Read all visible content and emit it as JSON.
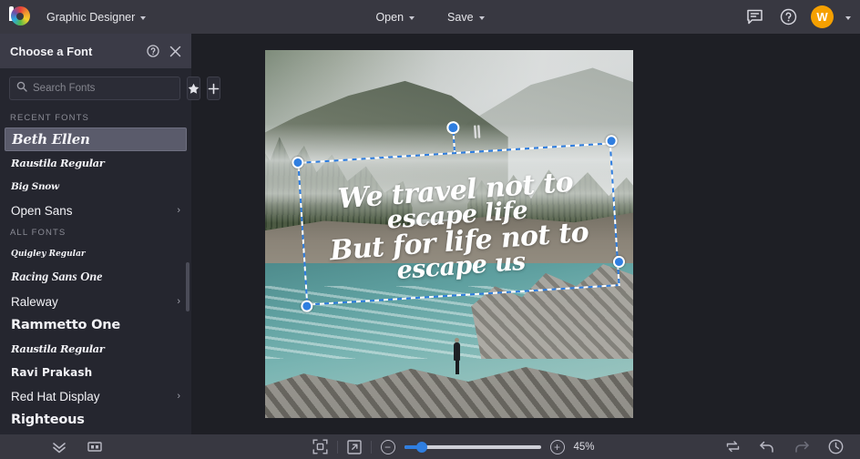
{
  "app": {
    "name": "BeFunky",
    "workspace_label": "Graphic Designer",
    "logo_icon": "befunky-logo-icon"
  },
  "topbar": {
    "open_label": "Open",
    "save_label": "Save",
    "chat_icon": "chat-bubble-icon",
    "help_icon": "question-circle-icon",
    "avatar_initial": "W",
    "avatar_color": "#f5a000"
  },
  "panel": {
    "title": "Choose a Font",
    "help_icon": "question-circle-icon",
    "close_icon": "close-x-icon",
    "search": {
      "placeholder": "Search Fonts",
      "value": "",
      "icon": "search-icon"
    },
    "favorites_icon": "star-icon",
    "add_icon": "plus-icon",
    "sections": [
      {
        "label": "RECENT FONTS",
        "fonts": [
          {
            "name": "Beth Ellen",
            "style": "f-script",
            "selected": true,
            "chevron": false
          },
          {
            "name": "Raustila Regular",
            "style": "f-script-s",
            "selected": false,
            "chevron": false
          },
          {
            "name": "Big Snow",
            "style": "f-bigsnow",
            "selected": false,
            "chevron": false
          },
          {
            "name": "Open Sans",
            "style": "f-sans",
            "selected": false,
            "chevron": true
          }
        ]
      },
      {
        "label": "ALL FONTS",
        "fonts": [
          {
            "name": "Quigley Regular",
            "style": "f-tiny",
            "selected": false,
            "chevron": false
          },
          {
            "name": "Racing Sans One",
            "style": "f-bolditl",
            "selected": false,
            "chevron": false
          },
          {
            "name": "Raleway",
            "style": "f-sans",
            "selected": false,
            "chevron": true
          },
          {
            "name": "Rammetto One",
            "style": "f-heavy",
            "selected": false,
            "chevron": false
          },
          {
            "name": "Raustila Regular",
            "style": "f-script-s",
            "selected": false,
            "chevron": false
          },
          {
            "name": "Ravi Prakash",
            "style": "f-semib",
            "selected": false,
            "chevron": false
          },
          {
            "name": "Red Hat Display",
            "style": "f-sans",
            "selected": false,
            "chevron": true
          },
          {
            "name": "Righteous",
            "style": "f-heavy",
            "selected": false,
            "chevron": false
          }
        ]
      }
    ],
    "bottom_icons": [
      {
        "name": "collapse-chevrons-icon"
      },
      {
        "name": "panels-layout-icon"
      }
    ]
  },
  "canvas": {
    "selected_text": {
      "line1": "We travel not to",
      "line2": "escape life",
      "line3": "But for life not to",
      "line4": "escape us",
      "color": "#ffffff"
    },
    "selection": {
      "handle_color": "#2f7ee0",
      "handle_count": 5,
      "rotate_handle": "rotate-handle"
    }
  },
  "bottombar": {
    "fit_icon": "fit-to-screen-icon",
    "expand_icon": "fullscreen-expand-icon",
    "zoom_out_icon": "zoom-out-minus-icon",
    "zoom_in_icon": "zoom-in-plus-icon",
    "zoom_value": "45%",
    "zoom_percent": 45,
    "slider_fill_percent": 12,
    "compare_icon": "compare-swap-icon",
    "undo_icon": "undo-arrow-icon",
    "redo_icon": "redo-arrow-icon",
    "history_icon": "history-clock-icon"
  }
}
